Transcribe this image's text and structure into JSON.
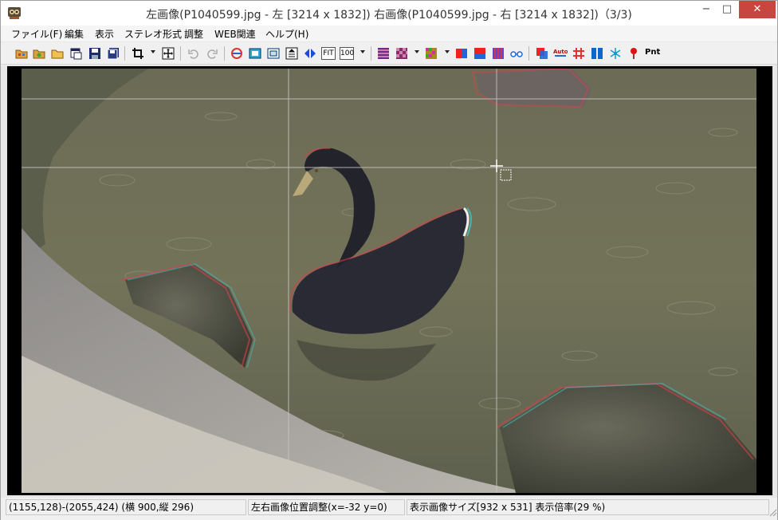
{
  "window": {
    "title": "左画像(P1040599.jpg - 左 [3214 x 1832]) 右画像(P1040599.jpg - 右 [3214 x 1832])（3/3)",
    "minimize_glyph": "−",
    "maximize_glyph": "□",
    "close_glyph": "✕"
  },
  "menu": {
    "items": [
      {
        "label": "ファイル(F)"
      },
      {
        "label": "編集"
      },
      {
        "label": "表示"
      },
      {
        "label": "ステレオ形式"
      },
      {
        "label": "調整"
      },
      {
        "label": "WEB関連"
      },
      {
        "label": "ヘルプ(H)"
      }
    ]
  },
  "toolbar": {
    "fit_label": "FIT",
    "zoom100_label": "100",
    "auto_label": "Auto",
    "pnt_label": "Pnt"
  },
  "status": {
    "selection": "(1155,128)-(2055,424) (横 900,縦 296)",
    "offset": "左右画像位置調整(x=-32 y=0)",
    "display": "表示画像サイズ[932 x 531]  表示倍率(29 %)"
  },
  "colors": {
    "close_button": "#c7463f",
    "title_background": "#ffffff",
    "canvas_background": "#000000",
    "water": "#6f7052",
    "swan": "#2a2a35",
    "anaglyph_red": "#d8404a",
    "anaglyph_cyan": "#3cc4c8"
  }
}
